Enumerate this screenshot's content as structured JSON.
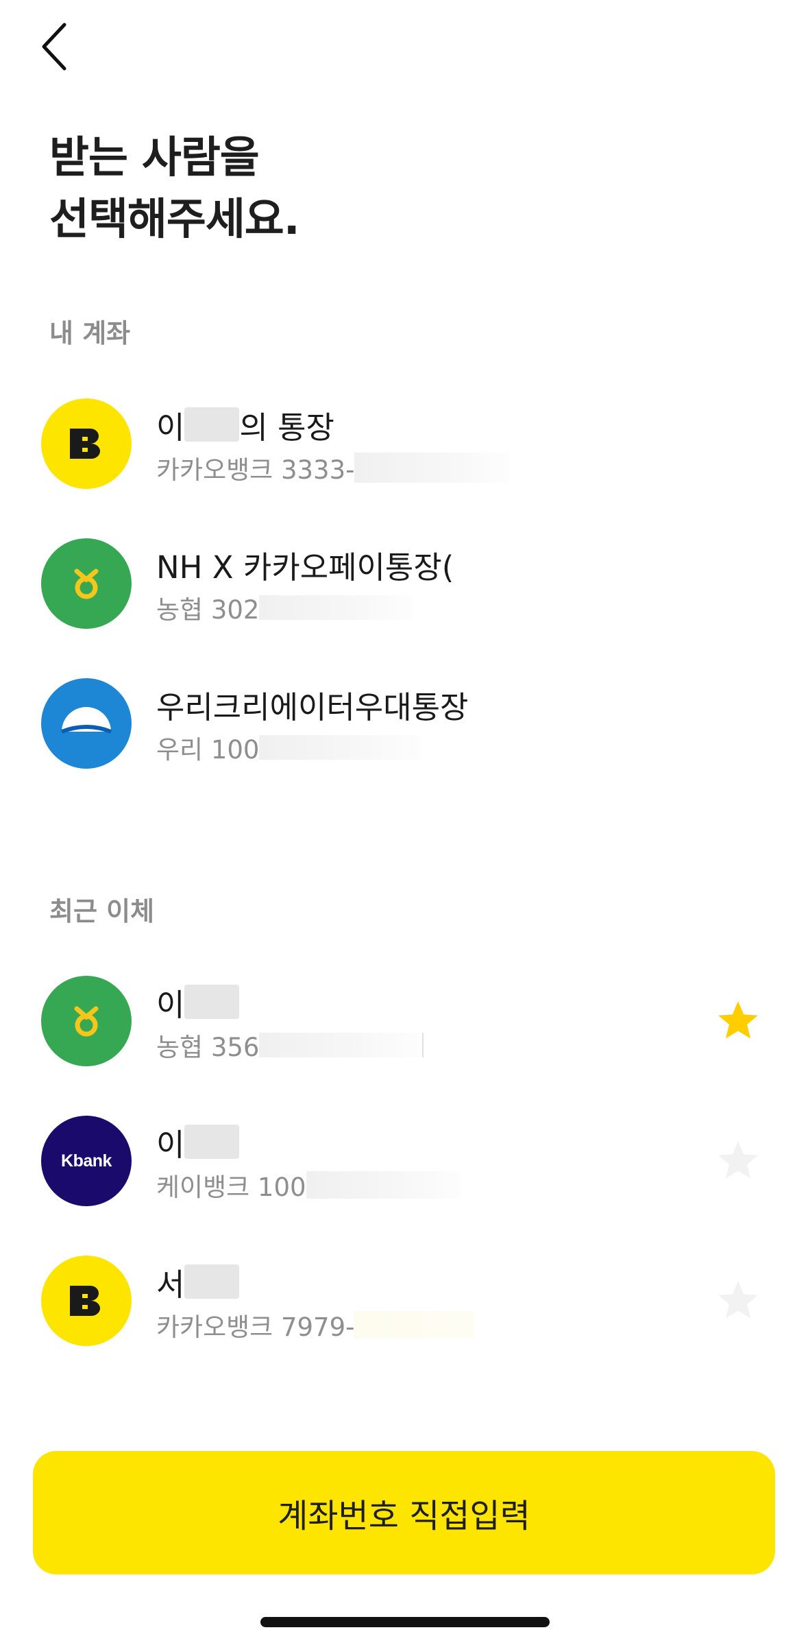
{
  "header": {
    "back_icon": "chevron-left-icon"
  },
  "title": {
    "line1": "받는 사람을",
    "line2": "선택해주세요."
  },
  "my_accounts": {
    "label": "내 계좌",
    "items": [
      {
        "bank": "kakaobank",
        "name_prefix": "이",
        "name_suffix": "의 통장",
        "account_number": "카카오뱅크 3333-"
      },
      {
        "bank": "nh",
        "name_prefix": "NH X 카카오페이통장(",
        "name_suffix": "",
        "account_number": "농협 302"
      },
      {
        "bank": "woori",
        "name_prefix": "우리크리에이터우대통장",
        "name_suffix": "",
        "account_number": "우리 100"
      }
    ]
  },
  "recent_transfers": {
    "label": "최근 이체",
    "items": [
      {
        "bank": "nh",
        "name_prefix": "이",
        "account_number": "농협 356",
        "favorite": true
      },
      {
        "bank": "kbank",
        "name_prefix": "이",
        "account_number": "케이뱅크 100",
        "favorite": false
      },
      {
        "bank": "kakaobank",
        "name_prefix": "서",
        "account_number": "카카오뱅크 7979-",
        "favorite": false
      }
    ]
  },
  "kbank_logo_text": "Kbank",
  "cta": {
    "label": "계좌번호 직접입력"
  },
  "colors": {
    "kakao_yellow": "#fee500",
    "nh_green": "#36a853",
    "woori_blue": "#1d87d6",
    "kbank_navy": "#1a0a6b",
    "star_active": "#ffcd00",
    "star_inactive": "#f2f2f2"
  }
}
